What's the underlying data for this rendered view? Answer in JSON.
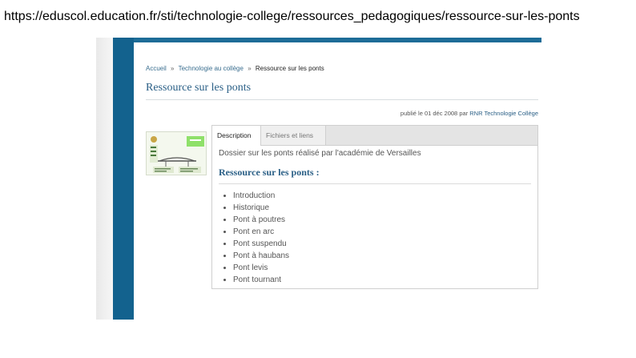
{
  "caption": {
    "url": "https://eduscol.education.fr/sti/technologie-college/ressources_pedagogiques/ressource-sur-les-ponts"
  },
  "breadcrumb": {
    "home": "Accueil",
    "separator": "»",
    "section": "Technologie au collège",
    "current": "Ressource sur les ponts"
  },
  "page": {
    "title": "Ressource sur les ponts",
    "published_prefix": "publié le 01 déc 2008 par",
    "author": "RNR Technologie Collège"
  },
  "tabs": [
    {
      "label": "Description",
      "active": true
    },
    {
      "label": "Fichiers et liens",
      "active": false
    }
  ],
  "description": {
    "intro": "Dossier sur les ponts réalisé par l'académie de Versailles",
    "section_title": "Ressource sur les ponts :",
    "items": [
      "Introduction",
      "Historique",
      "Pont à poutres",
      "Pont en arc",
      "Pont suspendu",
      "Pont à haubans",
      "Pont levis",
      "Pont tournant"
    ]
  },
  "colors": {
    "sidebar": "#13628e",
    "link": "#2a5f86",
    "tab_bar": "#e4e4e4"
  },
  "icons": {
    "thumbnail": "bridge-document-thumbnail"
  }
}
